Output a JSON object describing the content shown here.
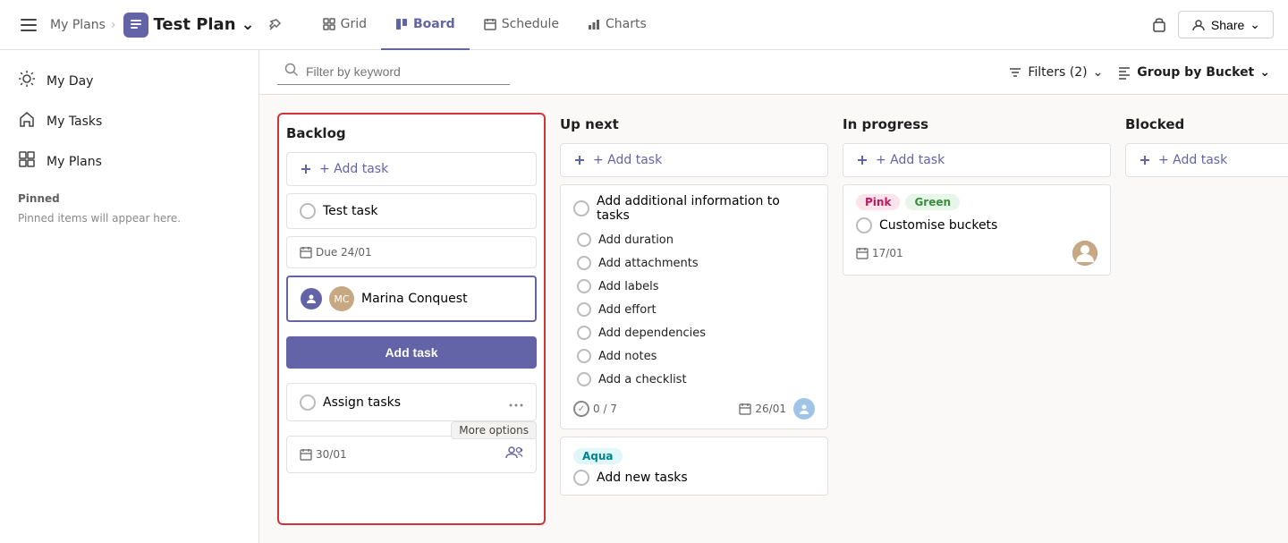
{
  "topbar": {
    "sidebar_toggle_label": "☰",
    "breadcrumb_myplans": "My Plans",
    "breadcrumb_sep": "›",
    "plan_title": "Test Plan",
    "plan_icon": "📋",
    "chevron": "⌄",
    "pin_icon": "📌",
    "tabs": [
      {
        "id": "grid",
        "label": "Grid",
        "icon": "⊞",
        "active": false
      },
      {
        "id": "board",
        "label": "Board",
        "icon": "⊡",
        "active": true
      },
      {
        "id": "schedule",
        "label": "Schedule",
        "icon": "📅",
        "active": false
      },
      {
        "id": "charts",
        "label": "Charts",
        "icon": "📊",
        "active": false
      }
    ],
    "lock_icon": "🔒",
    "share_label": "Share",
    "share_icon": "👤"
  },
  "sidebar": {
    "items": [
      {
        "id": "my-day",
        "icon": "☀",
        "label": "My Day"
      },
      {
        "id": "my-tasks",
        "icon": "🏠",
        "label": "My Tasks"
      },
      {
        "id": "my-plans",
        "icon": "⊞",
        "label": "My Plans"
      }
    ],
    "pinned_label": "Pinned",
    "pinned_empty": "Pinned items will appear here."
  },
  "filter_bar": {
    "search_placeholder": "Filter by keyword",
    "search_icon": "🔍",
    "filters_label": "Filters (2)",
    "filters_icon": "≡",
    "filters_chevron": "⌄",
    "group_label": "Group by Bucket",
    "group_icon": "≣",
    "group_chevron": "⌄"
  },
  "board": {
    "columns": [
      {
        "id": "backlog",
        "title": "Backlog",
        "selected": true,
        "add_task_label": "+ Add task"
      },
      {
        "id": "up-next",
        "title": "Up next",
        "add_task_label": "+ Add task"
      },
      {
        "id": "in-progress",
        "title": "In progress",
        "add_task_label": "+ Add task"
      },
      {
        "id": "blocked",
        "title": "Blocked",
        "add_task_label": "+ Add task"
      }
    ]
  },
  "backlog": {
    "add_task_label": "+ Add task",
    "test_task_title": "Test task",
    "due_label": "Due 24/01",
    "assignee_name": "Marina Conquest",
    "add_task_submit": "Add task",
    "assign_task_label": "Assign tasks",
    "assign_date": "30/01",
    "more_options_tooltip": "More options"
  },
  "upnext": {
    "add_task_label": "+ Add task",
    "main_task": "Add additional information to tasks",
    "dropdown_items": [
      "Add duration",
      "Add attachments",
      "Add labels",
      "Add effort",
      "Add dependencies",
      "Add notes",
      "Add a checklist"
    ],
    "progress": "0 / 7",
    "date": "26/01"
  },
  "inprogress": {
    "add_task_label": "+ Add task",
    "label1": "Pink",
    "label2": "Green",
    "task_title": "Customise buckets",
    "date": "17/01"
  },
  "blocked": {
    "add_task_label": "+ Add task"
  }
}
